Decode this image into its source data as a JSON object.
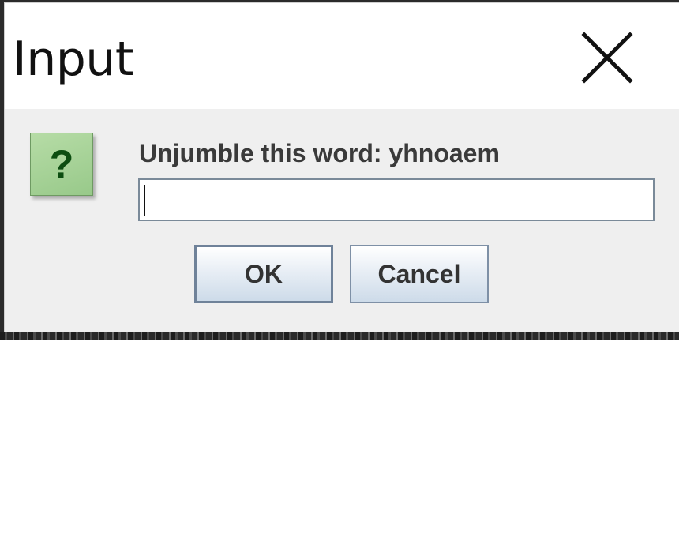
{
  "dialog": {
    "title": "Input",
    "close_icon": "close-icon",
    "question_icon": "question-icon",
    "question_glyph": "?",
    "prompt": "Unjumble this word: yhnoaem",
    "input_value": "",
    "ok_label": "OK",
    "cancel_label": "Cancel"
  },
  "colors": {
    "titlebar_bg": "#ffffff",
    "dialog_bg": "#efefef",
    "icon_green": "#98c98a",
    "icon_glyph": "#0c4d10",
    "button_border": "#7e90a6"
  }
}
